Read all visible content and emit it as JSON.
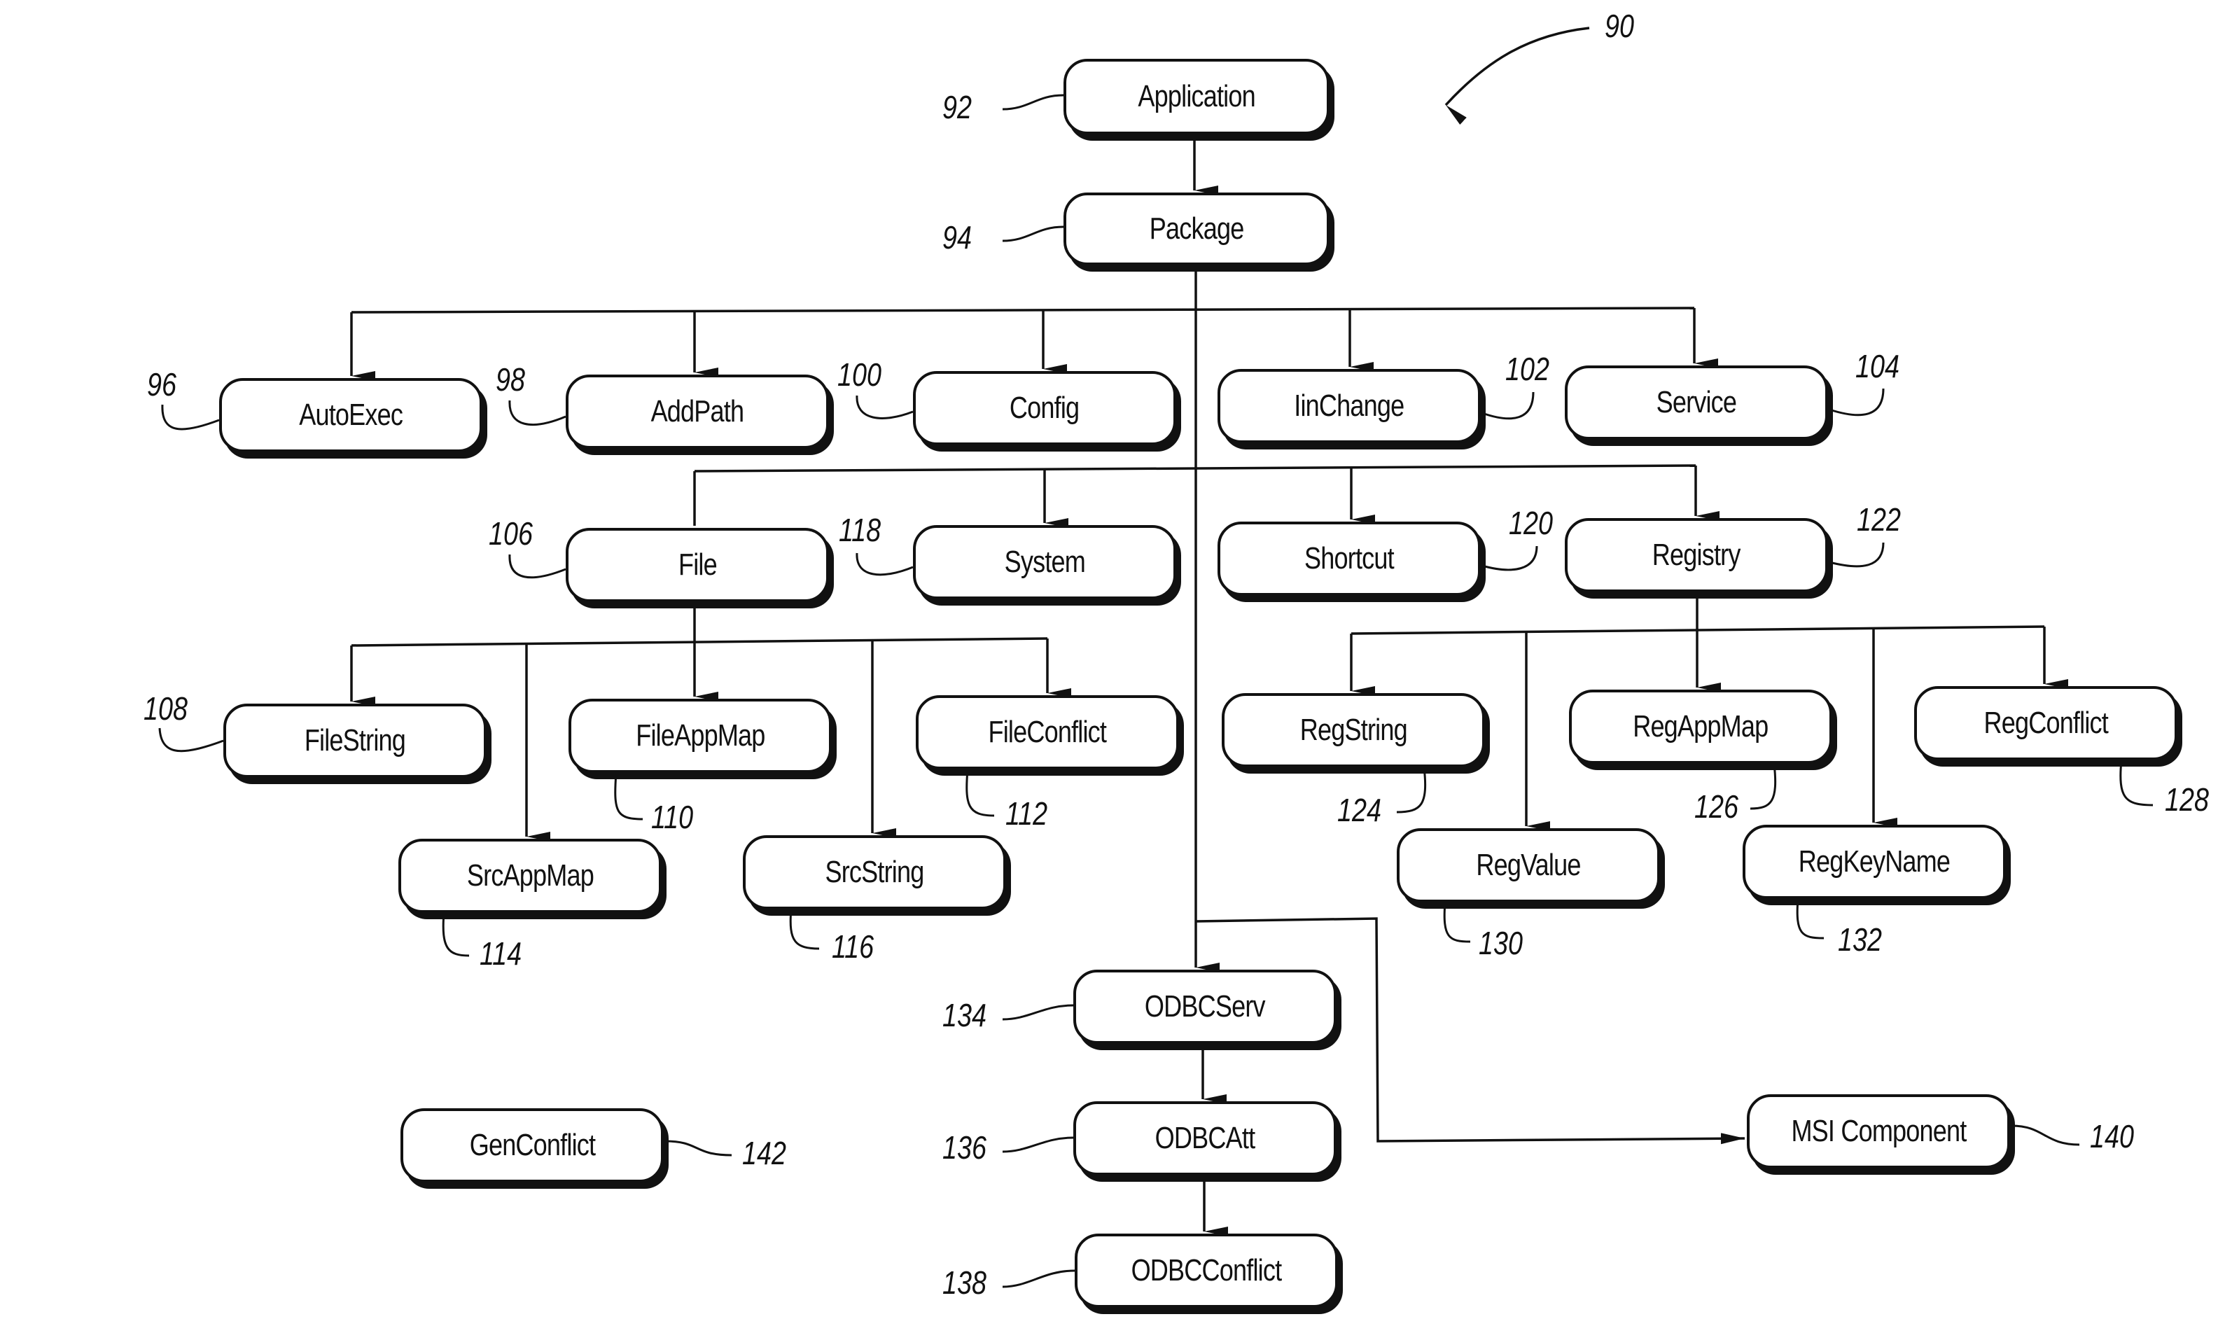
{
  "figure": {
    "reference": "90",
    "nodes": [
      {
        "id": "application",
        "label": "Application",
        "ref": "92"
      },
      {
        "id": "package",
        "label": "Package",
        "ref": "94"
      },
      {
        "id": "autoexec",
        "label": "AutoExec",
        "ref": "96"
      },
      {
        "id": "addpath",
        "label": "AddPath",
        "ref": "98"
      },
      {
        "id": "config",
        "label": "Config",
        "ref": "100"
      },
      {
        "id": "iinchange",
        "label": "IinChange",
        "ref": "102"
      },
      {
        "id": "service",
        "label": "Service",
        "ref": "104"
      },
      {
        "id": "file",
        "label": "File",
        "ref": "106"
      },
      {
        "id": "filestring",
        "label": "FileString",
        "ref": "108"
      },
      {
        "id": "fileappmap",
        "label": "FileAppMap",
        "ref": "110"
      },
      {
        "id": "fileconflict",
        "label": "FileConflict",
        "ref": "112"
      },
      {
        "id": "srcappmap",
        "label": "SrcAppMap",
        "ref": "114"
      },
      {
        "id": "srcstring",
        "label": "SrcString",
        "ref": "116"
      },
      {
        "id": "system",
        "label": "System",
        "ref": "118"
      },
      {
        "id": "shortcut",
        "label": "Shortcut",
        "ref": "120"
      },
      {
        "id": "registry",
        "label": "Registry",
        "ref": "122"
      },
      {
        "id": "regstring",
        "label": "RegString",
        "ref": "124"
      },
      {
        "id": "regappmap",
        "label": "RegAppMap",
        "ref": "126"
      },
      {
        "id": "regconflict",
        "label": "RegConflict",
        "ref": "128"
      },
      {
        "id": "regvalue",
        "label": "RegValue",
        "ref": "130"
      },
      {
        "id": "regkeyname",
        "label": "RegKeyName",
        "ref": "132"
      },
      {
        "id": "odbcserv",
        "label": "ODBCServ",
        "ref": "134"
      },
      {
        "id": "odbcatt",
        "label": "ODBCAtt",
        "ref": "136"
      },
      {
        "id": "odbcconflict",
        "label": "ODBCConflict",
        "ref": "138"
      },
      {
        "id": "msicomponent",
        "label": "MSI Component",
        "ref": "140"
      },
      {
        "id": "genconflict",
        "label": "GenConflict",
        "ref": "142"
      }
    ],
    "edges": [
      [
        "application",
        "package"
      ],
      [
        "package",
        "autoexec"
      ],
      [
        "package",
        "addpath"
      ],
      [
        "package",
        "config"
      ],
      [
        "package",
        "iinchange"
      ],
      [
        "package",
        "service"
      ],
      [
        "package",
        "file"
      ],
      [
        "package",
        "system"
      ],
      [
        "package",
        "shortcut"
      ],
      [
        "package",
        "registry"
      ],
      [
        "file",
        "filestring"
      ],
      [
        "file",
        "srcappmap"
      ],
      [
        "file",
        "fileappmap"
      ],
      [
        "file",
        "srcstring"
      ],
      [
        "file",
        "fileconflict"
      ],
      [
        "registry",
        "regstring"
      ],
      [
        "registry",
        "regvalue"
      ],
      [
        "registry",
        "regappmap"
      ],
      [
        "registry",
        "regkeyname"
      ],
      [
        "registry",
        "regconflict"
      ],
      [
        "package",
        "odbcserv"
      ],
      [
        "odbcserv",
        "odbcatt"
      ],
      [
        "odbcatt",
        "odbcconflict"
      ],
      [
        "package",
        "msicomponent"
      ]
    ]
  }
}
